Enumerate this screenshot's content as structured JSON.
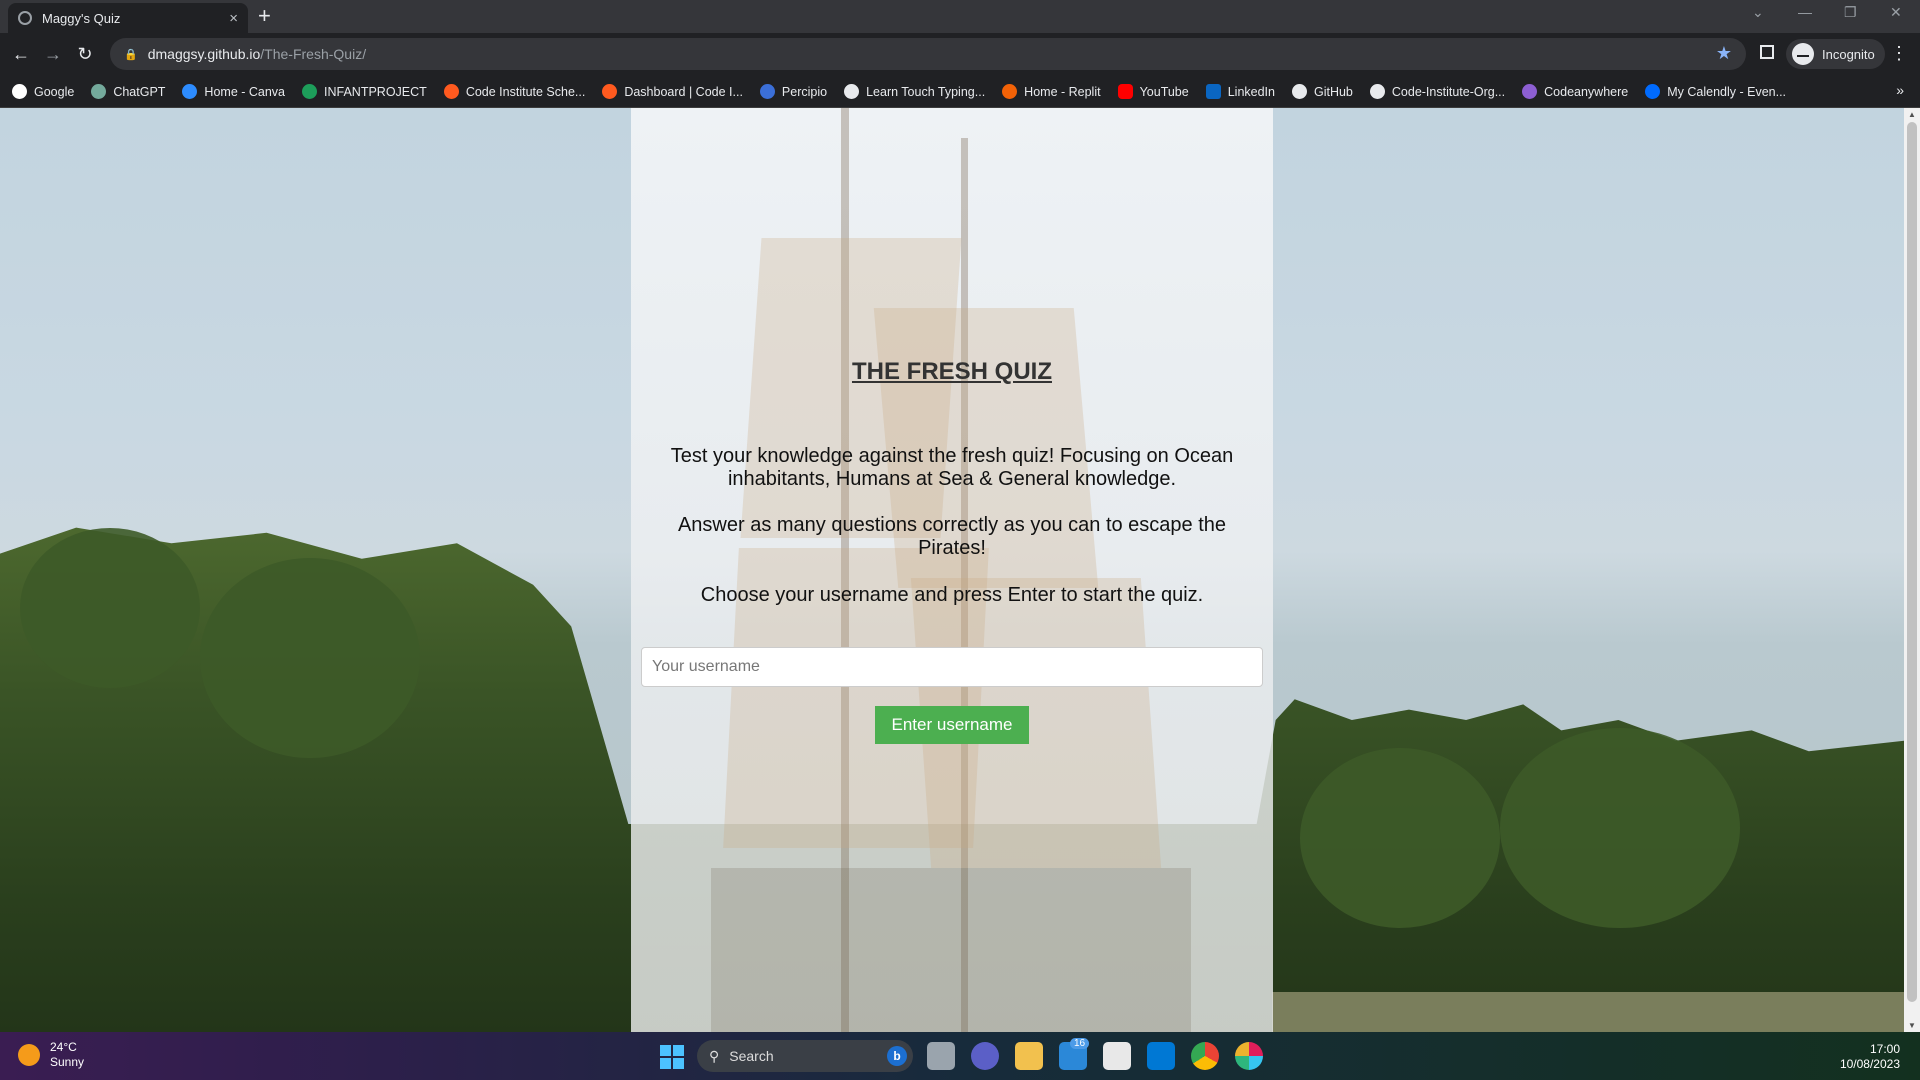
{
  "browser": {
    "tab_title": "Maggy's Quiz",
    "tab_close": "×",
    "new_tab": "+",
    "url_domain": "dmaggsy.github.io",
    "url_path": "/The-Fresh-Quiz/",
    "profile_label": "Incognito",
    "window_controls": [
      "⌄",
      "—",
      "❐",
      "✕"
    ]
  },
  "bookmarks": [
    {
      "label": "Google",
      "color": "#ffffff"
    },
    {
      "label": "ChatGPT",
      "color": "#74aa9c"
    },
    {
      "label": "Home - Canva",
      "color": "#2d8cff"
    },
    {
      "label": "INFANTPROJECT",
      "color": "#1d9e5a"
    },
    {
      "label": "Code Institute Sche...",
      "color": "#ff5a1f"
    },
    {
      "label": "Dashboard | Code I...",
      "color": "#ff5a1f"
    },
    {
      "label": "Percipio",
      "color": "#3b6fd8"
    },
    {
      "label": "Learn Touch Typing...",
      "color": "#e8eaed"
    },
    {
      "label": "Home - Replit",
      "color": "#f26207"
    },
    {
      "label": "YouTube",
      "color": "#ff0000"
    },
    {
      "label": "LinkedIn",
      "color": "#0a66c2"
    },
    {
      "label": "GitHub",
      "color": "#e8eaed"
    },
    {
      "label": "Code-Institute-Org...",
      "color": "#e8eaed"
    },
    {
      "label": "Codeanywhere",
      "color": "#8d5fd3"
    },
    {
      "label": "My Calendly - Even...",
      "color": "#006bff"
    }
  ],
  "page": {
    "title": "THE FRESH QUIZ",
    "intro": "Test your knowledge against the fresh quiz! Focusing on Ocean inhabitants, Humans at Sea & General knowledge.",
    "goal": "Answer as many questions correctly as you can to escape the Pirates!",
    "instruction": "Choose your username and press Enter to start the quiz.",
    "username_placeholder": "Your username",
    "username_value": "",
    "enter_button": "Enter username",
    "button_color": "#4caf50"
  },
  "taskbar": {
    "weather_temp": "24°C",
    "weather_desc": "Sunny",
    "search_label": "Search",
    "mail_badge": "16",
    "time": "17:00",
    "date": "10/08/2023"
  }
}
